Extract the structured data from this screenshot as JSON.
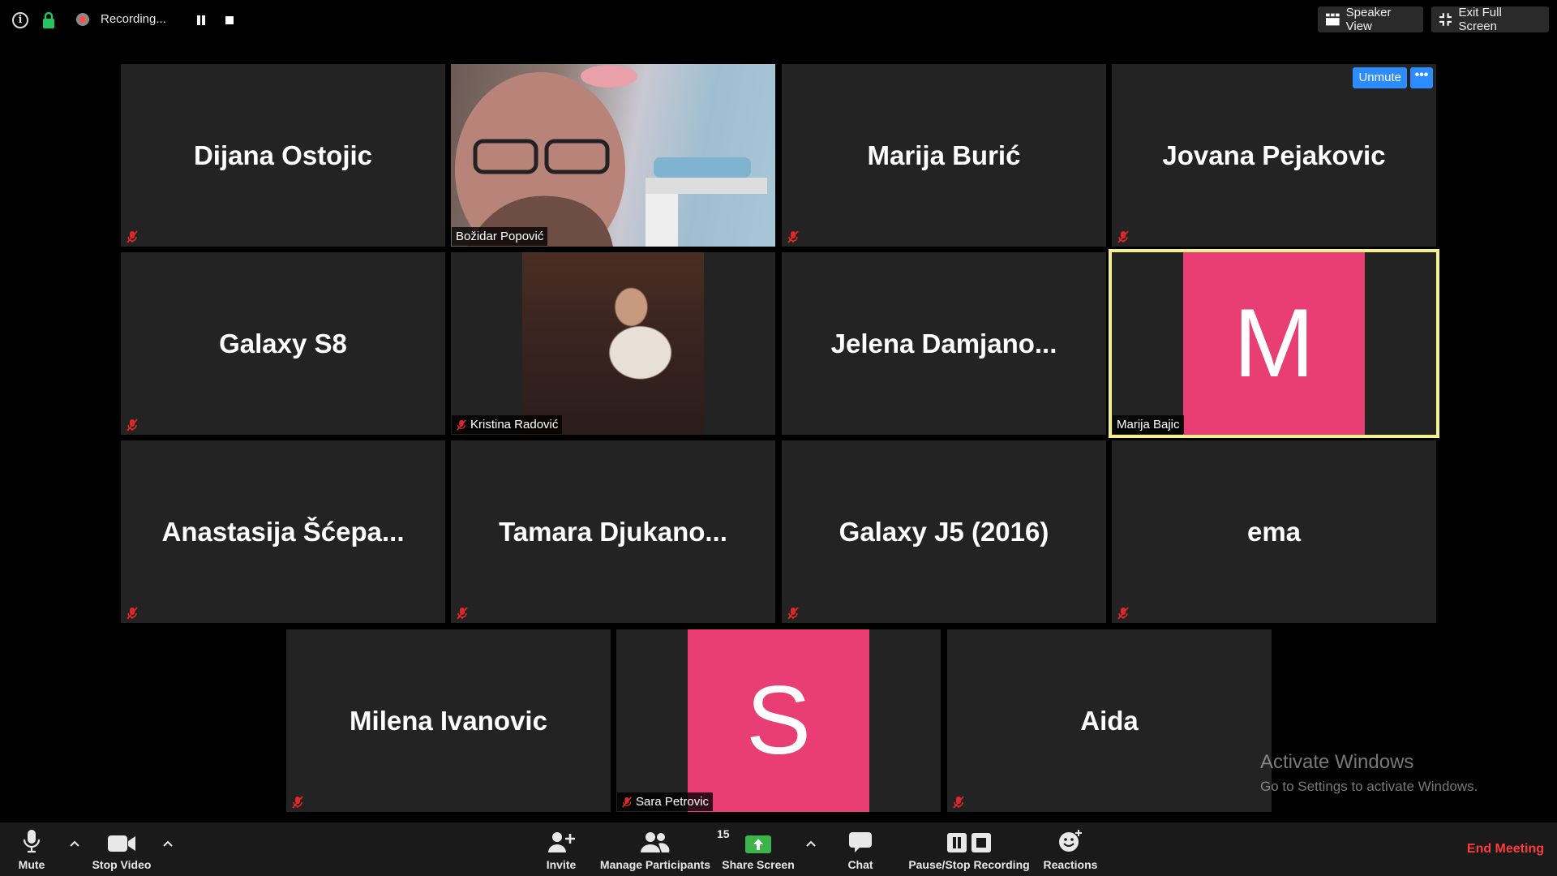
{
  "topbar": {
    "recording_text": "Recording...",
    "speaker_view_label": "Speaker View",
    "exit_fullscreen_label": "Exit Full Screen"
  },
  "tiles": [
    {
      "display": "Dijana Ostojic"
    },
    {
      "tag": "Božidar Popović"
    },
    {
      "display": "Marija Burić"
    },
    {
      "display": "Jovana Pejakovic",
      "unmute_label": "Unmute",
      "more_label": "•••"
    },
    {
      "display": "Galaxy S8"
    },
    {
      "tag": "Kristina Radović"
    },
    {
      "display": "Jelena  Damjano..."
    },
    {
      "avatar_letter": "M",
      "tag": "Marija Bajic"
    },
    {
      "display": "Anastasija  Šćepa..."
    },
    {
      "display": "Tamara  Djukano..."
    },
    {
      "display": "Galaxy J5 (2016)"
    },
    {
      "display": "ema"
    },
    {
      "display": "Milena Ivanovic"
    },
    {
      "avatar_letter": "S",
      "tag": "Sara Petrovic"
    },
    {
      "display": "Aida"
    }
  ],
  "watermark": {
    "line1": "Activate Windows",
    "line2": "Go to Settings to activate Windows."
  },
  "toolbar": {
    "mute": "Mute",
    "stop_video": "Stop Video",
    "invite": "Invite",
    "manage_participants": "Manage Participants",
    "participant_count": "15",
    "share_screen": "Share Screen",
    "chat": "Chat",
    "pause_stop_recording": "Pause/Stop Recording",
    "reactions": "Reactions",
    "end_meeting": "End Meeting"
  },
  "colors": {
    "avatar_pink": "#e83e73",
    "active_speaker_border": "#f5f18a",
    "unmute_blue": "#2d8cff",
    "share_green": "#3bb54a",
    "end_red": "#ff3b3b",
    "mic_off_red": "#e02828"
  }
}
